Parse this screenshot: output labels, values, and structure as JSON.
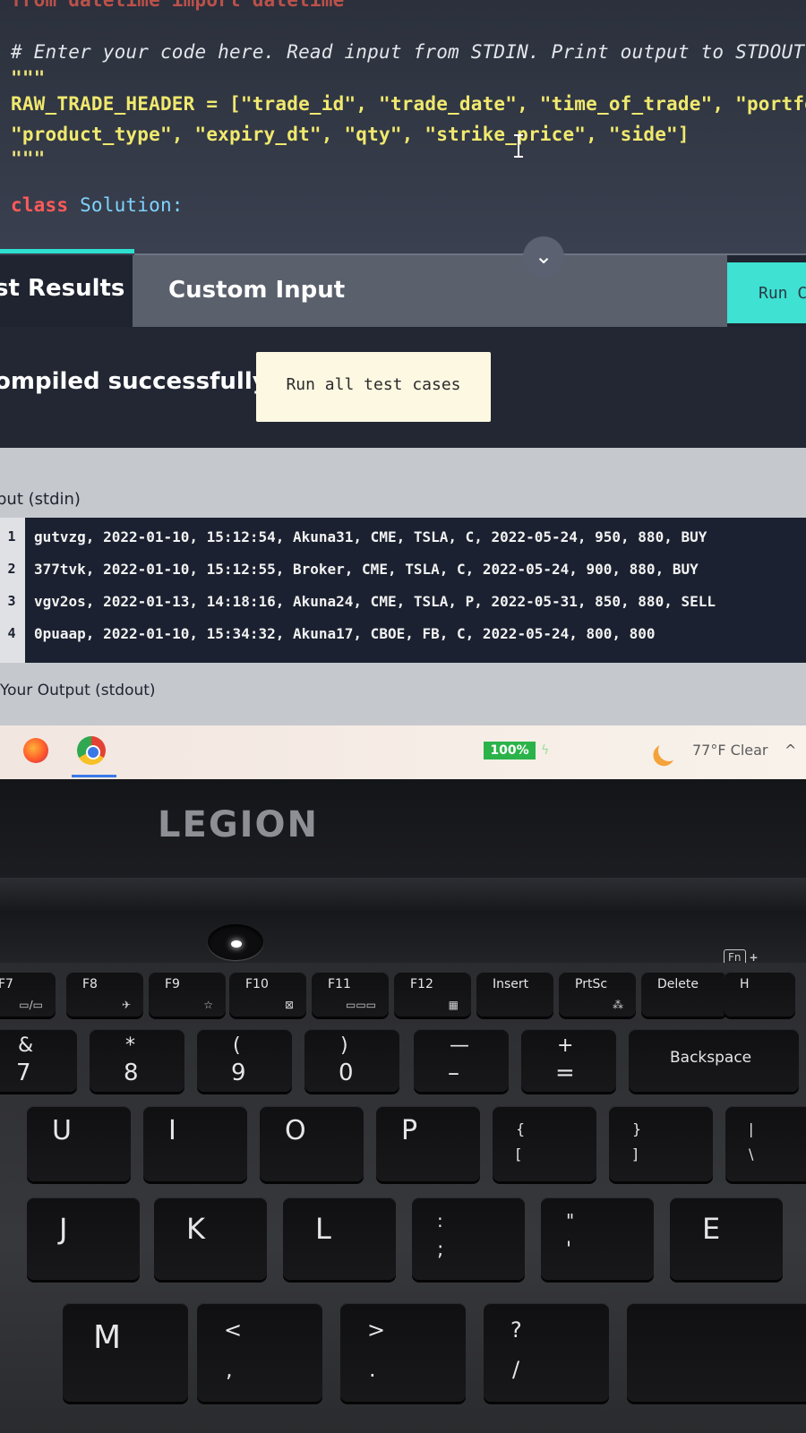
{
  "editor": {
    "top_line": "from datetime import datetime",
    "comment": "# Enter your code here. Read input from STDIN. Print output to STDOUT",
    "docstring_open": "\"\"\"",
    "header_line_1": "RAW_TRADE_HEADER = [\"trade_id\", \"trade_date\", \"time_of_trade\", \"portfoli",
    "header_line_2": "\"product_type\", \"expiry_dt\", \"qty\", \"strike_price\", \"side\"]",
    "docstring_close": "\"\"\"",
    "class_keyword": "class",
    "class_name": "Solution:"
  },
  "tabs": {
    "results_label": "st Results",
    "custom_input_label": "Custom Input",
    "run_code_label": "Run C"
  },
  "status": {
    "compiled_message": "ompiled successfully.",
    "run_all_label": "Run all test cases"
  },
  "stdin": {
    "label": "put (stdin)",
    "rows": [
      {
        "num": "1",
        "text": "gutvzg, 2022-01-10, 15:12:54, Akuna31, CME, TSLA, C, 2022-05-24, 950, 880, BUY"
      },
      {
        "num": "2",
        "text": "377tvk, 2022-01-10, 15:12:55, Broker, CME, TSLA, C, 2022-05-24, 900, 880, BUY"
      },
      {
        "num": "3",
        "text": "vgv2os, 2022-01-13, 14:18:16, Akuna24, CME, TSLA, P, 2022-05-31, 850, 880, SELL"
      },
      {
        "num": "4",
        "text": "0puaap, 2022-01-10, 15:34:32, Akuna17, CBOE, FB, C, 2022-05-24, 800, 800"
      }
    ]
  },
  "output": {
    "label": "Your Output (stdout)"
  },
  "taskbar": {
    "battery": "100%",
    "weather": "77°F  Clear",
    "chevron": "^"
  },
  "laptop": {
    "logo": "LEGION",
    "fn_hint": "Fn",
    "fn_plus": "+",
    "function_keys": [
      {
        "label": "F7",
        "sub": "▭/▭"
      },
      {
        "label": "F8",
        "sub": "✈"
      },
      {
        "label": "F9",
        "sub": "☆"
      },
      {
        "label": "F10",
        "sub": "⊠"
      },
      {
        "label": "F11",
        "sub": "▭▭▭"
      },
      {
        "label": "F12",
        "sub": "▦"
      },
      {
        "label": "Insert",
        "sub": ""
      },
      {
        "label": "PrtSc",
        "sub": "⁂"
      },
      {
        "label": "Delete",
        "sub": ""
      },
      {
        "label": "H",
        "sub": ""
      }
    ],
    "number_keys": [
      {
        "top": "&",
        "bottom": "7"
      },
      {
        "top": "*",
        "bottom": "8"
      },
      {
        "top": "(",
        "bottom": "9"
      },
      {
        "top": ")",
        "bottom": "0"
      },
      {
        "top": "—",
        "bottom": "–"
      },
      {
        "top": "+",
        "bottom": "="
      },
      {
        "top": "Backspace",
        "bottom": ""
      }
    ],
    "letter_row_1": [
      {
        "top": "U",
        "bottom": ""
      },
      {
        "top": "I",
        "bottom": ""
      },
      {
        "top": "O",
        "bottom": ""
      },
      {
        "top": "P",
        "bottom": ""
      },
      {
        "top": "{",
        "bottom": "["
      },
      {
        "top": "}",
        "bottom": "]"
      },
      {
        "top": "|",
        "bottom": "\\"
      }
    ],
    "letter_row_2": [
      {
        "top": "J",
        "bottom": ""
      },
      {
        "top": "K",
        "bottom": ""
      },
      {
        "top": "L",
        "bottom": ""
      },
      {
        "top": ":",
        "bottom": ";"
      },
      {
        "top": "\"",
        "bottom": "'"
      },
      {
        "top": "E",
        "bottom": ""
      }
    ],
    "letter_row_3": [
      {
        "top": "M",
        "bottom": ""
      },
      {
        "top": "<",
        "bottom": ","
      },
      {
        "top": ">",
        "bottom": "."
      },
      {
        "top": "?",
        "bottom": "/"
      }
    ]
  }
}
